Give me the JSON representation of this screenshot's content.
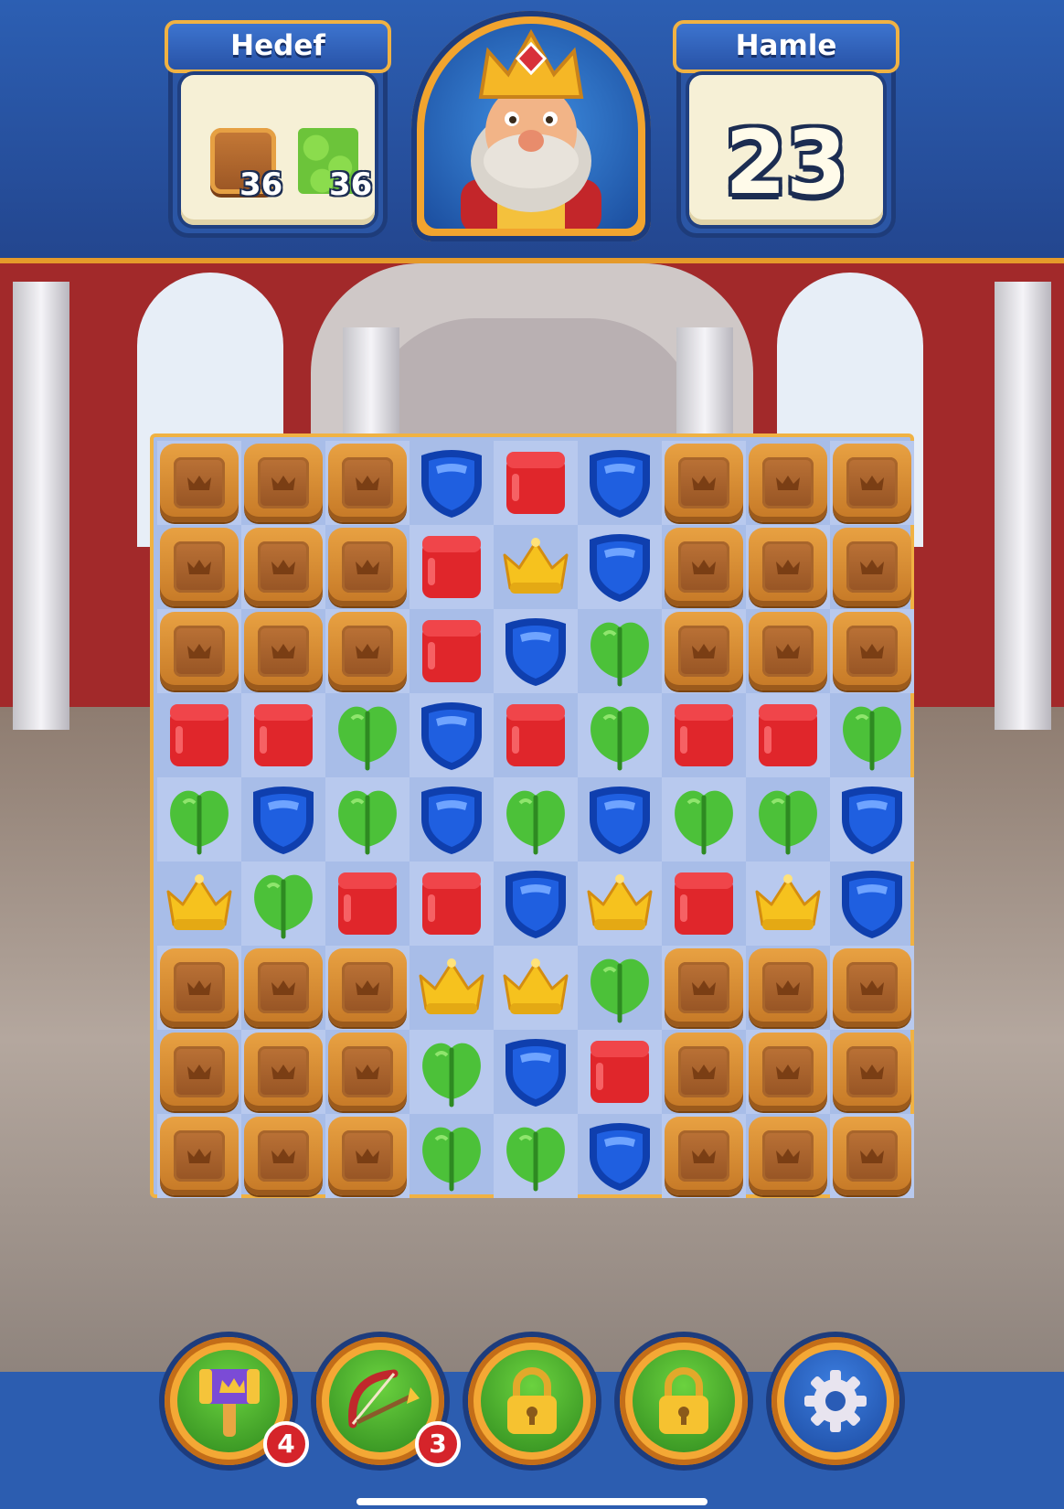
{
  "hud": {
    "goal_title": "Hedef",
    "moves_title": "Hamle",
    "moves_value": "23",
    "goals": [
      {
        "icon": "crate-icon",
        "count": "36"
      },
      {
        "icon": "grass-icon",
        "count": "36"
      }
    ]
  },
  "board": {
    "rows": [
      [
        "crate",
        "crate",
        "crate",
        "shield",
        "cube",
        "shield",
        "crate",
        "crate",
        "crate"
      ],
      [
        "crate",
        "crate",
        "crate",
        "cube",
        "crown",
        "shield",
        "crate",
        "crate",
        "crate"
      ],
      [
        "crate",
        "crate",
        "crate",
        "cube",
        "shield",
        "leaf",
        "crate",
        "crate",
        "crate"
      ],
      [
        "cube",
        "cube",
        "leaf",
        "shield",
        "cube",
        "leaf",
        "cube",
        "cube",
        "leaf"
      ],
      [
        "leaf",
        "shield",
        "leaf",
        "shield",
        "leaf",
        "shield",
        "leaf",
        "leaf",
        "shield"
      ],
      [
        "crown",
        "leaf",
        "cube",
        "cube",
        "shield",
        "crown",
        "cube",
        "crown",
        "shield"
      ],
      [
        "crate",
        "crate",
        "crate",
        "crown",
        "crown",
        "leaf",
        "crate",
        "crate",
        "crate"
      ],
      [
        "crate",
        "crate",
        "crate",
        "leaf",
        "shield",
        "cube",
        "crate",
        "crate",
        "crate"
      ],
      [
        "crate",
        "crate",
        "crate",
        "leaf",
        "leaf",
        "shield",
        "crate",
        "crate",
        "crate"
      ]
    ]
  },
  "boosters": [
    {
      "name": "hammer-booster",
      "icon": "hammer-icon",
      "count": "4"
    },
    {
      "name": "arrow-booster",
      "icon": "bow-arrow-icon",
      "count": "3"
    },
    {
      "name": "locked-booster-1",
      "icon": "lock-icon"
    },
    {
      "name": "locked-booster-2",
      "icon": "lock-icon"
    },
    {
      "name": "settings-button",
      "icon": "gear-icon"
    }
  ],
  "colors": {
    "cube": "#e0262b",
    "shield": "#1f5fe0",
    "leaf": "#4cc139",
    "crown": "#f6c21e",
    "crate": "#d78a34"
  }
}
